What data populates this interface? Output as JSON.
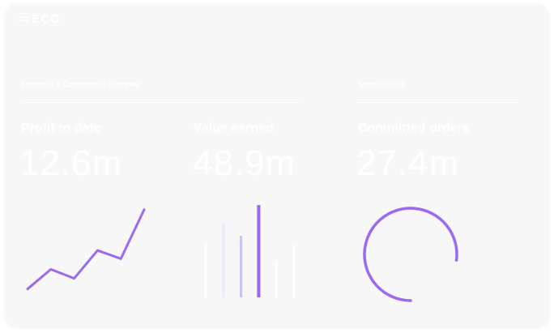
{
  "brand": {
    "logo_text": "ECG",
    "logo_icon": "hamburger-icon"
  },
  "sections": {
    "financial": {
      "title": "Financial & Commercial Overview"
    },
    "supply": {
      "title": "Supply Chain"
    }
  },
  "metrics": {
    "profit": {
      "label": "Profit to date",
      "value": "12.6m"
    },
    "value_earned": {
      "label": "Value earned",
      "value": "48.9m"
    },
    "committed": {
      "label": "Committed orders",
      "value": "27.4m"
    }
  },
  "colors": {
    "accent": "#9a6af0",
    "card_bg": "#f7f7f7",
    "text": "#ffffff"
  },
  "chart_data": [
    {
      "type": "line",
      "x": [
        1,
        2,
        3,
        4,
        5,
        6
      ],
      "values": [
        1,
        3.6,
        2.4,
        6.1,
        5.0,
        11.5
      ],
      "ylim": [
        0,
        12
      ]
    },
    {
      "type": "bar",
      "values": [
        6.5,
        9.0,
        7.4,
        11.1,
        4.4,
        6.3
      ],
      "highlight_index": 3,
      "ylim": [
        0,
        11.5
      ]
    },
    {
      "type": "pie",
      "progress": 0.77
    }
  ]
}
